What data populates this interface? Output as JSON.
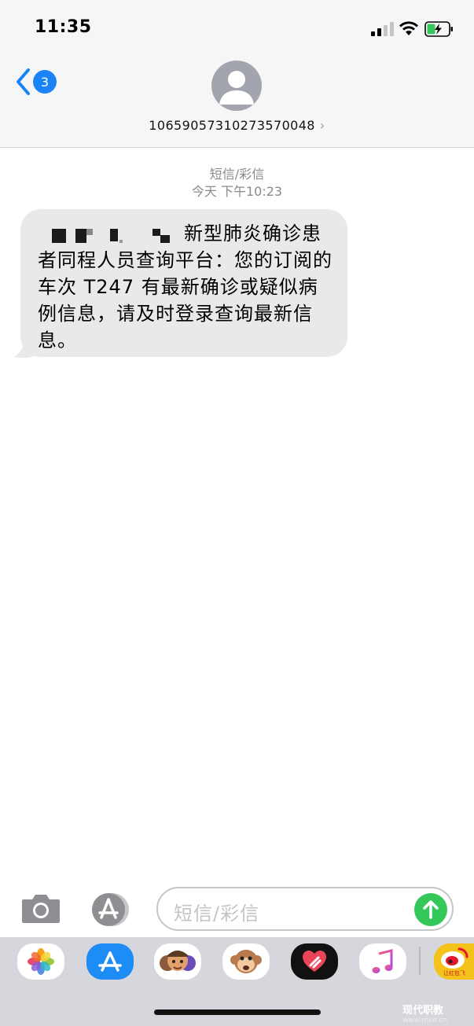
{
  "status_bar": {
    "time": "11:35",
    "icons": [
      "cellular-signal-icon",
      "wifi-icon",
      "battery-charging-icon"
    ]
  },
  "nav": {
    "back_badge_count": "3",
    "back_icon": "chevron-left-icon",
    "contact_number": "10659057310273570048",
    "contact_chevron": "›",
    "avatar_icon": "person-silhouette-icon"
  },
  "thread": {
    "timestamp_header": "短信/彩信",
    "timestamp": "今天 下午10:23",
    "messages": [
      {
        "direction": "incoming",
        "text": "新型肺炎确诊患者同程人员查询平台：您的订阅的车次 T247 有最新确诊或疑似病例信息，请及时登录查询最新信息。"
      }
    ]
  },
  "compose": {
    "placeholder": "短信/彩信",
    "camera_icon": "camera-icon",
    "apps_icon": "app-store-icon",
    "send_icon": "arrow-up-icon"
  },
  "app_drawer": {
    "apps": [
      "photos-icon",
      "app-store-icon",
      "memoji-icon",
      "animoji-monkey-icon",
      "digital-touch-icon",
      "music-icon",
      "weibo-icon"
    ],
    "weibo_label": "让红包飞"
  },
  "watermark": {
    "title": "现代职教",
    "url": "www.mve.cn"
  },
  "colors": {
    "accent": "#1a84f7",
    "send": "#34c759",
    "bubble": "#e9e9eb",
    "header_bg": "#f6f6f7",
    "drawer_bg": "#d6d7dc"
  }
}
